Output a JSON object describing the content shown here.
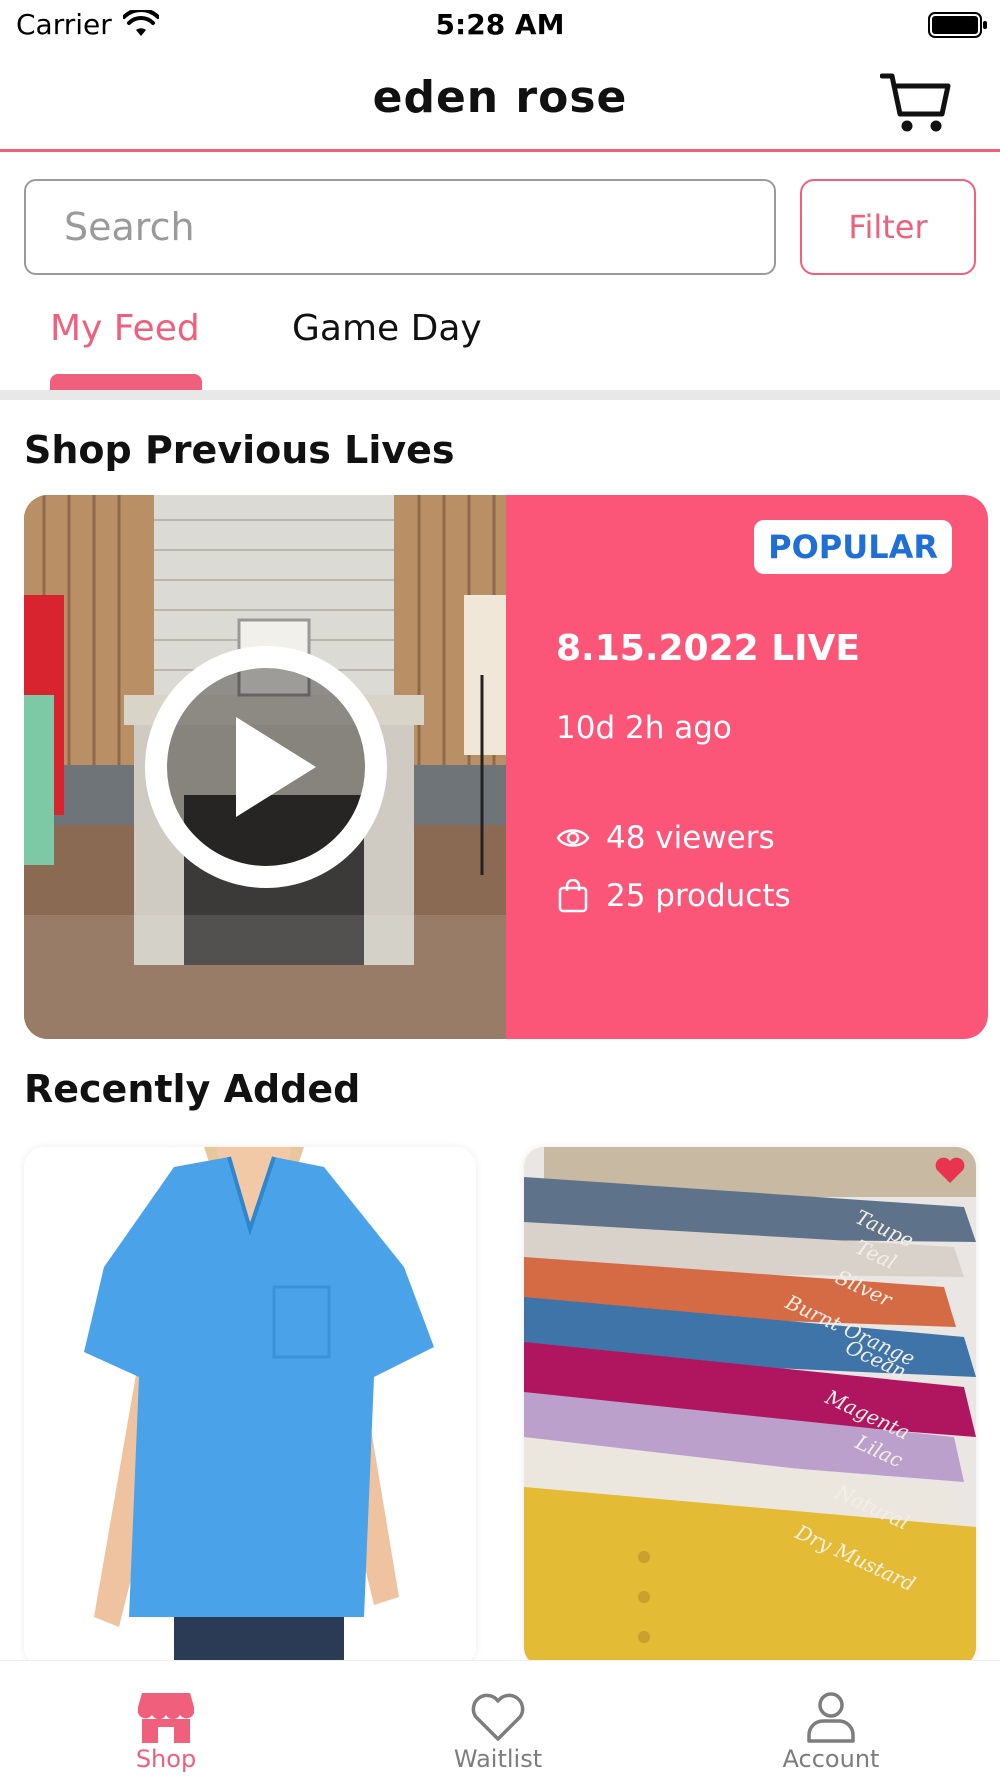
{
  "status_bar": {
    "carrier": "Carrier",
    "time": "5:28 AM"
  },
  "header": {
    "title": "eden rose",
    "cart_icon": "cart-icon"
  },
  "search": {
    "placeholder": "Search",
    "filter_label": "Filter"
  },
  "tabs": [
    {
      "label": "My Feed",
      "active": true
    },
    {
      "label": "Game Day",
      "active": false
    }
  ],
  "sections": {
    "previous_lives": "Shop Previous Lives",
    "recently_added": "Recently Added"
  },
  "live_card": {
    "badge": "POPULAR",
    "title": "8.15.2022 LIVE",
    "ago": "10d 2h ago",
    "viewers": "48 viewers",
    "products": "25 products"
  },
  "products": [
    {
      "name": "blue-vneck-top",
      "favorited": false
    },
    {
      "name": "gauze-tops-colors",
      "favorited": true,
      "printed_color_labels": [
        "Taupe",
        "Teal",
        "Silver",
        "Burnt Orange",
        "Ocean",
        "Magenta",
        "Lilac",
        "Natural",
        "Dry Mustard"
      ]
    }
  ],
  "bottom_nav": [
    {
      "label": "Shop",
      "icon": "shop-icon",
      "active": true
    },
    {
      "label": "Waitlist",
      "icon": "heart-icon",
      "active": false
    },
    {
      "label": "Account",
      "icon": "person-icon",
      "active": false
    }
  ],
  "colors": {
    "accent": "#f0607c",
    "live_card_bg": "#fb5677",
    "badge_text": "#1f6fd6"
  }
}
